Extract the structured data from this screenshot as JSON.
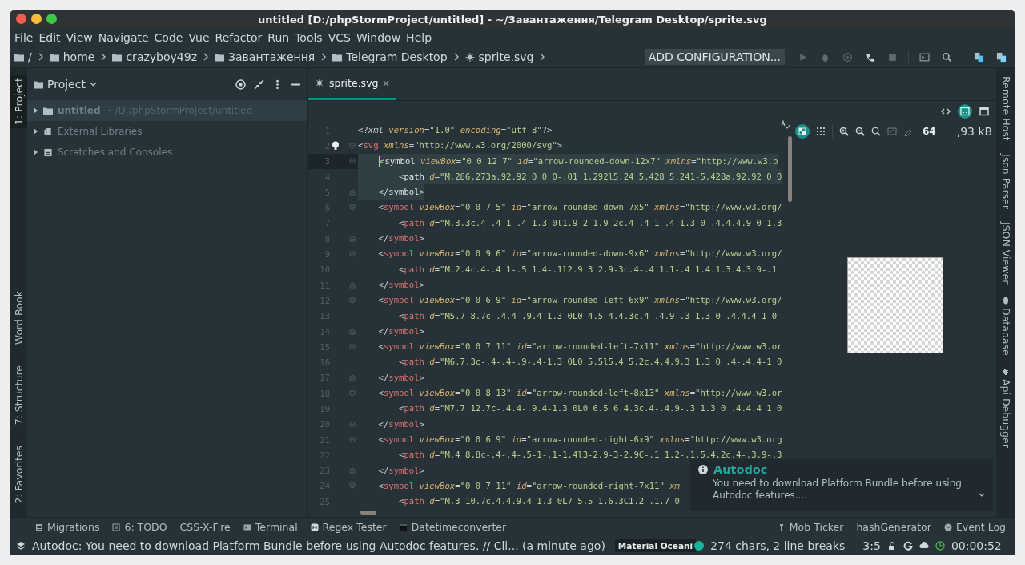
{
  "window": {
    "title": "untitled [D:/phpStormProject/untitled] - ~/Завантаження/Telegram Desktop/sprite.svg"
  },
  "menu": [
    "File",
    "Edit",
    "View",
    "Navigate",
    "Code",
    "Vue",
    "Refactor",
    "Run",
    "Tools",
    "VCS",
    "Window",
    "Help"
  ],
  "breadcrumbs": [
    {
      "label": "/",
      "kind": "folder"
    },
    {
      "label": "home",
      "kind": "folder"
    },
    {
      "label": "crazyboy49z",
      "kind": "folder"
    },
    {
      "label": "Завантаження",
      "kind": "folder"
    },
    {
      "label": "Telegram Desktop",
      "kind": "folder"
    },
    {
      "label": "sprite.svg",
      "kind": "svg"
    }
  ],
  "run_configuration": "ADD CONFIGURATION...",
  "left_tool_tabs": [
    {
      "label": "1: Project",
      "selected": true
    }
  ],
  "left_tool_tabs_bottom": [
    {
      "label": "Word Book",
      "selected": false
    },
    {
      "label": "7: Structure",
      "selected": false
    },
    {
      "label": "2: Favorites",
      "selected": false
    }
  ],
  "project_panel": {
    "title": "Project",
    "items": [
      {
        "label": "untitled",
        "path": "~/D:/phpStormProject/untitled",
        "kind": "folder",
        "expanded": false,
        "selected": true
      },
      {
        "label": "External Libraries",
        "kind": "library",
        "expanded": false,
        "selected": false
      },
      {
        "label": "Scratches and Consoles",
        "kind": "scratches",
        "expanded": false,
        "selected": false
      }
    ]
  },
  "editor_tabs": [
    {
      "label": "sprite.svg",
      "selected": true
    }
  ],
  "editor_modes": [
    {
      "kind": "text",
      "selected": false
    },
    {
      "kind": "split",
      "selected": true
    },
    {
      "kind": "preview",
      "selected": false
    }
  ],
  "code_lines": [
    {
      "number": "1",
      "text": "<?xml version=\"1.0\" encoding=\"utf-8\"?>",
      "highlighted": false,
      "kind": "plain"
    },
    {
      "number": "2",
      "text": "<svg xmlns=\"http://www.w3.org/2000/svg\">",
      "highlighted": false,
      "kind": "fold-start"
    },
    {
      "number": "3",
      "text": "    <symbol viewBox=\"0 0 12 7\" id=\"arrow-rounded-down-12x7\" xmlns=\"http://www.w3.o",
      "highlighted": true,
      "kind": "fold-start",
      "caret": true
    },
    {
      "number": "4",
      "text": "        <path d=\"M.286.273a.92.92 0 0 0-.01 1.292l5.24 5.428 5.241-5.428a.92.92 0 0",
      "highlighted": true,
      "kind": "plain"
    },
    {
      "number": "5",
      "text": "    </symbol>",
      "highlighted": true,
      "kind": "fold-end"
    },
    {
      "number": "6",
      "text": "    <symbol viewBox=\"0 0 7 5\" id=\"arrow-rounded-down-7x5\" xmlns=\"http://www.w3.org/",
      "highlighted": false,
      "kind": "fold-start"
    },
    {
      "number": "7",
      "text": "        <path d=\"M.3.3c.4-.4 1-.4 1.3 0l1.9 2 1.9-2c.4-.4 1-.4 1.3 0 .4.4.4.9 0 1.3",
      "highlighted": false,
      "kind": "plain"
    },
    {
      "number": "8",
      "text": "    </symbol>",
      "highlighted": false,
      "kind": "fold-end"
    },
    {
      "number": "9",
      "text": "    <symbol viewBox=\"0 0 9 6\" id=\"arrow-rounded-down-9x6\" xmlns=\"http://www.w3.org/",
      "highlighted": false,
      "kind": "fold-start"
    },
    {
      "number": "10",
      "text": "        <path d=\"M.2.4c.4-.4 1-.5 1.4-.1l2.9 3 2.9-3c.4-.4 1.1-.4 1.4.1.3.4.3.9-.1",
      "highlighted": false,
      "kind": "plain"
    },
    {
      "number": "11",
      "text": "    </symbol>",
      "highlighted": false,
      "kind": "fold-end"
    },
    {
      "number": "12",
      "text": "    <symbol viewBox=\"0 0 6 9\" id=\"arrow-rounded-left-6x9\" xmlns=\"http://www.w3.org/",
      "highlighted": false,
      "kind": "fold-start"
    },
    {
      "number": "13",
      "text": "        <path d=\"M5.7 8.7c-.4.4-.9.4-1.3 0L0 4.5 4.4.3c.4-.4.9-.3 1.3 0 .4.4.4 1 0",
      "highlighted": false,
      "kind": "plain"
    },
    {
      "number": "14",
      "text": "    </symbol>",
      "highlighted": false,
      "kind": "fold-end"
    },
    {
      "number": "15",
      "text": "    <symbol viewBox=\"0 0 7 11\" id=\"arrow-rounded-left-7x11\" xmlns=\"http://www.w3.or",
      "highlighted": false,
      "kind": "fold-start"
    },
    {
      "number": "16",
      "text": "        <path d=\"M6.7.3c-.4-.4-.9-.4-1.3 0L0 5.5l5.4 5.2c.4.4.9.3 1.3 0 .4-.4.4-1 0",
      "highlighted": false,
      "kind": "plain"
    },
    {
      "number": "17",
      "text": "    </symbol>",
      "highlighted": false,
      "kind": "fold-end"
    },
    {
      "number": "18",
      "text": "    <symbol viewBox=\"0 0 8 13\" id=\"arrow-rounded-left-8x13\" xmlns=\"http://www.w3.or",
      "highlighted": false,
      "kind": "fold-start"
    },
    {
      "number": "19",
      "text": "        <path d=\"M7.7 12.7c-.4.4-.9.4-1.3 0L0 6.5 6.4.3c.4-.4.9-.3 1.3 0 .4.4.4 1 0",
      "highlighted": false,
      "kind": "plain"
    },
    {
      "number": "20",
      "text": "    </symbol>",
      "highlighted": false,
      "kind": "fold-end"
    },
    {
      "number": "21",
      "text": "    <symbol viewBox=\"0 0 6 9\" id=\"arrow-rounded-right-6x9\" xmlns=\"http://www.w3.org",
      "highlighted": false,
      "kind": "fold-start"
    },
    {
      "number": "22",
      "text": "        <path d=\"M.4 8.8c-.4-.4-.5-1-.1-1.4l3-2.9-3-2.9C-.1 1.2-.1.5.4.2c.4-.3.9-.3",
      "highlighted": false,
      "kind": "plain"
    },
    {
      "number": "23",
      "text": "    </symbol>",
      "highlighted": false,
      "kind": "fold-end"
    },
    {
      "number": "24",
      "text": "    <symbol viewBox=\"0 0 7 11\" id=\"arrow-rounded-right-7x11\" xm",
      "highlighted": false,
      "kind": "fold-start"
    },
    {
      "number": "25",
      "text": "        <path d=\"M.3 10.7c.4.4.9.4 1.3 0L7 5.5 1.6.3C1.2-.1.7 0",
      "highlighted": false,
      "kind": "plain"
    }
  ],
  "preview_toolbar": {
    "chessboard": true,
    "zoom": "64",
    "file_size": ",93 kB"
  },
  "notification": {
    "title": "Autodoc",
    "body": "You need to download Platform Bundle before using Autodoc features...."
  },
  "right_tool_tabs": [
    {
      "label": "Remote Host",
      "kind": "plain"
    },
    {
      "label": "Json Parser",
      "kind": "plain"
    },
    {
      "label": "JSON Viewer",
      "kind": "plain"
    },
    {
      "label": "Database",
      "kind": "database"
    },
    {
      "label": "Api Debugger",
      "kind": "plug"
    }
  ],
  "tool_buttons_left": [
    {
      "label": "Migrations",
      "kind": "list"
    },
    {
      "label": "6: TODO",
      "kind": "todo"
    },
    {
      "label": "CSS-X-Fire",
      "kind": "none"
    },
    {
      "label": "Terminal",
      "kind": "terminal"
    },
    {
      "label": "Regex Tester",
      "kind": "regex"
    },
    {
      "label": "Datetimeconverter",
      "kind": "calendar"
    }
  ],
  "tool_buttons_right": [
    {
      "label": "Mob Ticker",
      "kind": "ticker"
    },
    {
      "label": "hashGenerator",
      "kind": "none"
    },
    {
      "label": "Event Log",
      "kind": "log"
    }
  ],
  "status_bar": {
    "message": "Autodoc: You need to download Platform Bundle before using Autodoc features. // Cli... (a minute ago)",
    "theme": "Material Oceani",
    "stats": "274 chars, 2 line breaks",
    "position": "3:5",
    "timer": "00:00:52"
  }
}
